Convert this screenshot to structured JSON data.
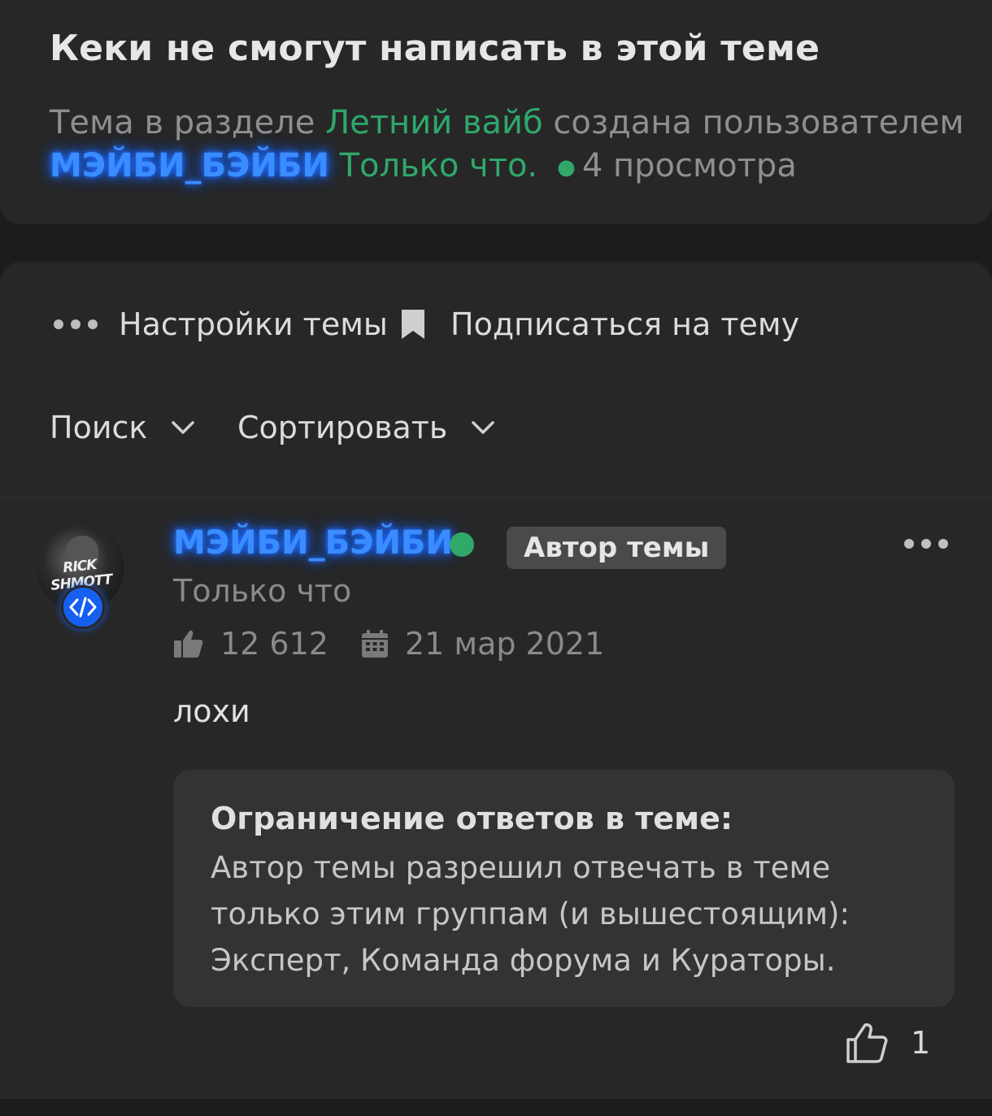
{
  "thread": {
    "title": "Кеки не смогут написать в этой теме",
    "meta_prefix": "Тема в разделе ",
    "section": "Летний вайб",
    "meta_middle": " создана пользователем",
    "author": "МЭЙБИ_БЭЙБИ",
    "created": "Только что.",
    "views": "4 просмотра"
  },
  "toolbar": {
    "settings_label": "Настройки темы",
    "subscribe_label": "Подписаться на тему",
    "search_label": "Поиск",
    "sort_label": "Сортировать"
  },
  "post": {
    "username": "МЭЙБИ_БЭЙБИ",
    "author_badge": "Автор темы",
    "time": "Только что",
    "likes_total": "12 612",
    "registered": "21 мар 2021",
    "body": "лохи",
    "avatar_text": "RICK SHMOTT",
    "like_count": "1"
  },
  "restriction": {
    "title": "Ограничение ответов в теме:",
    "lines": [
      "Автор темы разрешил отвечать в теме",
      "только этим группам (и вышестоящим):",
      "Эксперт, Команда форума и Кураторы."
    ]
  },
  "icons": {
    "menu": "more-dots-icon",
    "bookmark": "bookmark-icon",
    "chevron": "chevron-down-icon",
    "thumb": "thumbs-up-icon",
    "calendar": "calendar-icon",
    "code": "code-icon"
  },
  "colors": {
    "background": "#1c1c1c",
    "card": "#272727",
    "green": "#2fa86a",
    "username_glow": "#3a8cff",
    "badge": "#4a4a4a"
  }
}
